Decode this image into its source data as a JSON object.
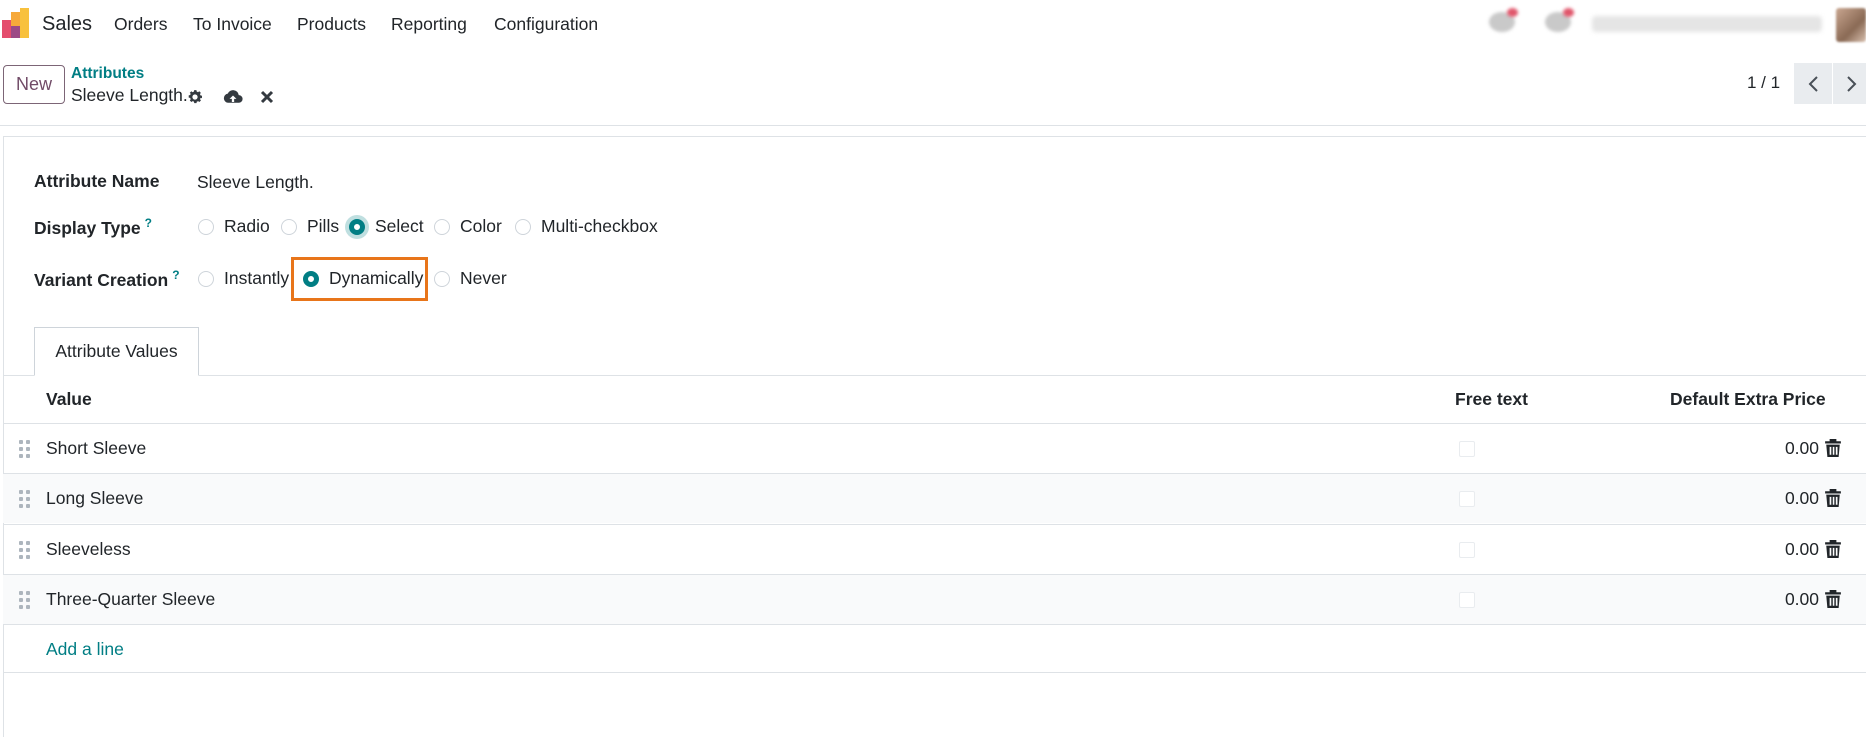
{
  "app": {
    "name": "Sales",
    "menu": [
      "Orders",
      "To Invoice",
      "Products",
      "Reporting",
      "Configuration"
    ],
    "icons": [
      "app-logo-icon",
      "chat-icon",
      "activity-icon",
      "avatar"
    ]
  },
  "control_panel": {
    "new_label": "New",
    "breadcrumb": "Attributes",
    "record_name": "Sleeve Length.",
    "pager": "1 / 1",
    "icons": [
      "gear-icon",
      "cloud-upload-icon",
      "close-icon",
      "chevron-left-icon",
      "chevron-right-icon"
    ]
  },
  "form": {
    "attribute_name_label": "Attribute Name",
    "attribute_name_value": "Sleeve Length.",
    "display_type_label": "Display Type",
    "help_mark": "?",
    "display_type_options": [
      "Radio",
      "Pills",
      "Select",
      "Color",
      "Multi-checkbox"
    ],
    "display_type_selected": "Select",
    "variant_creation_label": "Variant Creation",
    "variant_creation_options": [
      "Instantly",
      "Dynamically",
      "Never"
    ],
    "variant_creation_selected": "Dynamically",
    "highlight_color": "#e8751a"
  },
  "tabs": {
    "attribute_values": "Attribute Values"
  },
  "table": {
    "headers": {
      "value": "Value",
      "free_text": "Free text",
      "default_extra_price": "Default Extra Price"
    },
    "rows": [
      {
        "value": "Short Sleeve",
        "free_text": false,
        "price": "0.00"
      },
      {
        "value": "Long Sleeve",
        "free_text": false,
        "price": "0.00"
      },
      {
        "value": "Sleeveless",
        "free_text": false,
        "price": "0.00"
      },
      {
        "value": "Three-Quarter Sleeve",
        "free_text": false,
        "price": "0.00"
      }
    ],
    "add_line": "Add a line"
  },
  "colors": {
    "brand": "#714b67",
    "accent": "#017e84"
  }
}
